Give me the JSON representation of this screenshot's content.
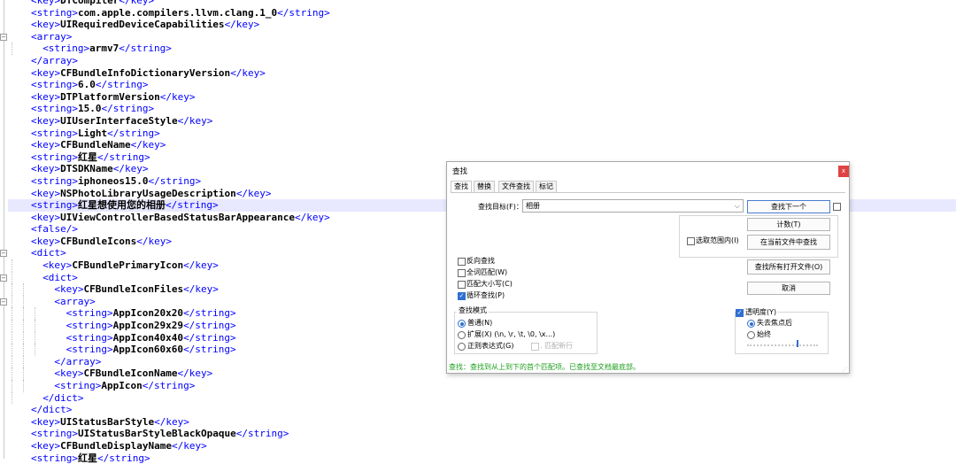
{
  "editor": {
    "lines": [
      {
        "ind": 0,
        "parts": [
          [
            "t",
            "<key>"
          ],
          [
            "x",
            "DTCompiler"
          ],
          [
            "t",
            "</key>"
          ]
        ]
      },
      {
        "ind": 0,
        "parts": [
          [
            "t",
            "<string>"
          ],
          [
            "x",
            "com.apple.compilers.llvm.clang.1_0"
          ],
          [
            "t",
            "</string>"
          ]
        ]
      },
      {
        "ind": 0,
        "parts": [
          [
            "t",
            "<key>"
          ],
          [
            "x",
            "UIRequiredDeviceCapabilities"
          ],
          [
            "t",
            "</key>"
          ]
        ]
      },
      {
        "ind": 0,
        "fold": "open",
        "parts": [
          [
            "t",
            "<array>"
          ]
        ]
      },
      {
        "ind": 1,
        "parts": [
          [
            "t",
            "<string>"
          ],
          [
            "x",
            "armv7"
          ],
          [
            "t",
            "</string>"
          ]
        ]
      },
      {
        "ind": 0,
        "parts": [
          [
            "t",
            "</array>"
          ]
        ]
      },
      {
        "ind": 0,
        "parts": [
          [
            "t",
            "<key>"
          ],
          [
            "x",
            "CFBundleInfoDictionaryVersion"
          ],
          [
            "t",
            "</key>"
          ]
        ]
      },
      {
        "ind": 0,
        "parts": [
          [
            "t",
            "<string>"
          ],
          [
            "x",
            "6.0"
          ],
          [
            "t",
            "</string>"
          ]
        ]
      },
      {
        "ind": 0,
        "parts": [
          [
            "t",
            "<key>"
          ],
          [
            "x",
            "DTPlatformVersion"
          ],
          [
            "t",
            "</key>"
          ]
        ]
      },
      {
        "ind": 0,
        "parts": [
          [
            "t",
            "<string>"
          ],
          [
            "x",
            "15.0"
          ],
          [
            "t",
            "</string>"
          ]
        ]
      },
      {
        "ind": 0,
        "parts": [
          [
            "t",
            "<key>"
          ],
          [
            "x",
            "UIUserInterfaceStyle"
          ],
          [
            "t",
            "</key>"
          ]
        ]
      },
      {
        "ind": 0,
        "parts": [
          [
            "t",
            "<string>"
          ],
          [
            "x",
            "Light"
          ],
          [
            "t",
            "</string>"
          ]
        ]
      },
      {
        "ind": 0,
        "parts": [
          [
            "t",
            "<key>"
          ],
          [
            "x",
            "CFBundleName"
          ],
          [
            "t",
            "</key>"
          ]
        ]
      },
      {
        "ind": 0,
        "parts": [
          [
            "t",
            "<string>"
          ],
          [
            "x",
            "红星"
          ],
          [
            "t",
            "</string>"
          ]
        ]
      },
      {
        "ind": 0,
        "parts": [
          [
            "t",
            "<key>"
          ],
          [
            "x",
            "DTSDKName"
          ],
          [
            "t",
            "</key>"
          ]
        ]
      },
      {
        "ind": 0,
        "parts": [
          [
            "t",
            "<string>"
          ],
          [
            "x",
            "iphoneos15.0"
          ],
          [
            "t",
            "</string>"
          ]
        ]
      },
      {
        "ind": 0,
        "parts": [
          [
            "t",
            "<key>"
          ],
          [
            "x",
            "NSPhotoLibraryUsageDescription"
          ],
          [
            "t",
            "</key>"
          ]
        ]
      },
      {
        "ind": 0,
        "hl": true,
        "parts": [
          [
            "t",
            "<string>"
          ],
          [
            "x",
            "红星想使用您的相册"
          ],
          [
            "t",
            "</string>"
          ]
        ]
      },
      {
        "ind": 0,
        "parts": [
          [
            "t",
            "<key>"
          ],
          [
            "x",
            "UIViewControllerBasedStatusBarAppearance"
          ],
          [
            "t",
            "</key>"
          ]
        ]
      },
      {
        "ind": 0,
        "parts": [
          [
            "t",
            "<false/>"
          ]
        ]
      },
      {
        "ind": 0,
        "parts": [
          [
            "t",
            "<key>"
          ],
          [
            "x",
            "CFBundleIcons"
          ],
          [
            "t",
            "</key>"
          ]
        ]
      },
      {
        "ind": 0,
        "fold": "open",
        "parts": [
          [
            "t",
            "<dict>"
          ]
        ]
      },
      {
        "ind": 1,
        "parts": [
          [
            "t",
            "<key>"
          ],
          [
            "x",
            "CFBundlePrimaryIcon"
          ],
          [
            "t",
            "</key>"
          ]
        ]
      },
      {
        "ind": 1,
        "fold": "open",
        "parts": [
          [
            "t",
            "<dict>"
          ]
        ]
      },
      {
        "ind": 2,
        "parts": [
          [
            "t",
            "<key>"
          ],
          [
            "x",
            "CFBundleIconFiles"
          ],
          [
            "t",
            "</key>"
          ]
        ]
      },
      {
        "ind": 2,
        "fold": "open",
        "parts": [
          [
            "t",
            "<array>"
          ]
        ]
      },
      {
        "ind": 3,
        "parts": [
          [
            "t",
            "<string>"
          ],
          [
            "x",
            "AppIcon20x20"
          ],
          [
            "t",
            "</string>"
          ]
        ]
      },
      {
        "ind": 3,
        "parts": [
          [
            "t",
            "<string>"
          ],
          [
            "x",
            "AppIcon29x29"
          ],
          [
            "t",
            "</string>"
          ]
        ]
      },
      {
        "ind": 3,
        "parts": [
          [
            "t",
            "<string>"
          ],
          [
            "x",
            "AppIcon40x40"
          ],
          [
            "t",
            "</string>"
          ]
        ]
      },
      {
        "ind": 3,
        "parts": [
          [
            "t",
            "<string>"
          ],
          [
            "x",
            "AppIcon60x60"
          ],
          [
            "t",
            "</string>"
          ]
        ]
      },
      {
        "ind": 2,
        "parts": [
          [
            "t",
            "</array>"
          ]
        ]
      },
      {
        "ind": 2,
        "parts": [
          [
            "t",
            "<key>"
          ],
          [
            "x",
            "CFBundleIconName"
          ],
          [
            "t",
            "</key>"
          ]
        ]
      },
      {
        "ind": 2,
        "parts": [
          [
            "t",
            "<string>"
          ],
          [
            "x",
            "AppIcon"
          ],
          [
            "t",
            "</string>"
          ]
        ]
      },
      {
        "ind": 1,
        "parts": [
          [
            "t",
            "</dict>"
          ]
        ]
      },
      {
        "ind": 0,
        "parts": [
          [
            "t",
            "</dict>"
          ]
        ]
      },
      {
        "ind": 0,
        "parts": [
          [
            "t",
            "<key>"
          ],
          [
            "x",
            "UIStatusBarStyle"
          ],
          [
            "t",
            "</key>"
          ]
        ]
      },
      {
        "ind": 0,
        "parts": [
          [
            "t",
            "<string>"
          ],
          [
            "x",
            "UIStatusBarStyleBlackOpaque"
          ],
          [
            "t",
            "</string>"
          ]
        ]
      },
      {
        "ind": 0,
        "parts": [
          [
            "t",
            "<key>"
          ],
          [
            "x",
            "CFBundleDisplayName"
          ],
          [
            "t",
            "</key>"
          ]
        ]
      },
      {
        "ind": 0,
        "parts": [
          [
            "t",
            "<string>"
          ],
          [
            "x",
            "红星"
          ],
          [
            "t",
            "</string>"
          ]
        ]
      }
    ]
  },
  "dialog": {
    "title": "查找",
    "close_label": "x",
    "tabs": [
      "查找",
      "替换",
      "文件查找",
      "标记"
    ],
    "find_label": "查找目标(F)：",
    "find_value": "相册",
    "combo_arrow": "⌵",
    "buttons": {
      "find_next": "查找下一个",
      "count": "计数(T)",
      "find_in_current": "在当前文件中查找",
      "find_all_open": "查找所有打开文件(O)",
      "cancel": "取消"
    },
    "in_selection": {
      "label": "选取范围内(I)",
      "checked": false
    },
    "options": [
      {
        "label": "反向查找",
        "checked": false
      },
      {
        "label": "全词匹配(W)",
        "checked": false
      },
      {
        "label": "匹配大小写(C)",
        "checked": false
      },
      {
        "label": "循环查找(P)",
        "checked": true
      }
    ],
    "search_mode": {
      "title": "查找模式",
      "modes": [
        {
          "label": "普通(N)",
          "selected": true
        },
        {
          "label": "扩展(X) (\\n, \\r, \\t, \\0, \\x...)",
          "selected": false
        },
        {
          "label": "正则表达式(G)",
          "selected": false
        }
      ],
      "dot_newline": ". 匹配新行"
    },
    "transparency": {
      "label": "透明度(Y)",
      "checked": true,
      "modes": [
        {
          "label": "失去焦点后",
          "selected": true
        },
        {
          "label": "始终",
          "selected": false
        }
      ],
      "level": 0.7
    },
    "status": "查找：查找到从上到下的首个匹配项。已查找至文档最底部。",
    "grip": "⋰"
  }
}
